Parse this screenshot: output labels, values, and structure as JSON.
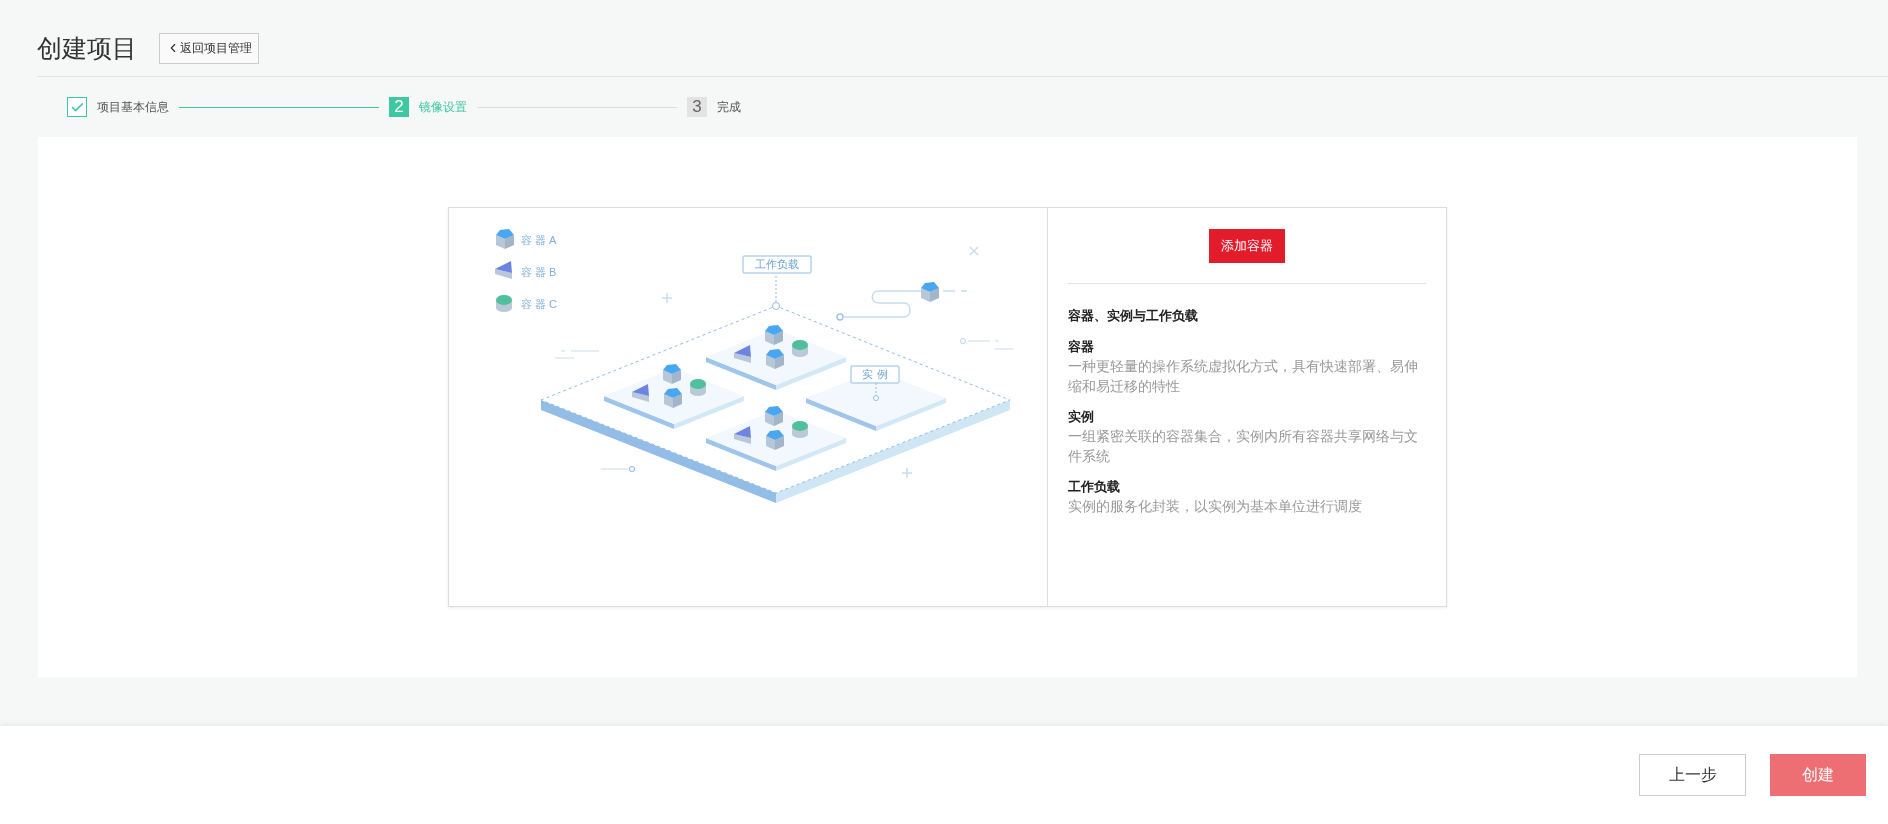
{
  "header": {
    "title": "创建项目",
    "back_button": "返回项目管理"
  },
  "steps": [
    {
      "label": "项目基本信息",
      "done": true,
      "selected": false
    },
    {
      "number": "2",
      "label": "镜像设置",
      "done": false,
      "selected": true
    },
    {
      "number": "3",
      "label": "完成",
      "done": false,
      "selected": false
    }
  ],
  "illustration": {
    "legend": [
      {
        "label": "容 器 A",
        "kind": "cube"
      },
      {
        "label": "容 器 B",
        "kind": "prism"
      },
      {
        "label": "容 器 C",
        "kind": "cylinder"
      }
    ],
    "workload_label": "工作负载",
    "instance_label": "实 例"
  },
  "info": {
    "add_button": "添加容器",
    "heading": "容器、实例与工作负载",
    "sections": [
      {
        "title": "容器",
        "text": "一种更轻量的操作系统虚拟化方式，具有快速部署、易伸缩和易迁移的特性"
      },
      {
        "title": "实例",
        "text": "一组紧密关联的容器集合，实例内所有容器共享网络与文件系统"
      },
      {
        "title": "工作负载",
        "text": "实例的服务化封装，以实例为基本单位进行调度"
      }
    ]
  },
  "footer": {
    "buttons": [
      {
        "label": "上一步",
        "kind": "secondary"
      },
      {
        "label": "创建",
        "kind": "primary"
      }
    ]
  }
}
